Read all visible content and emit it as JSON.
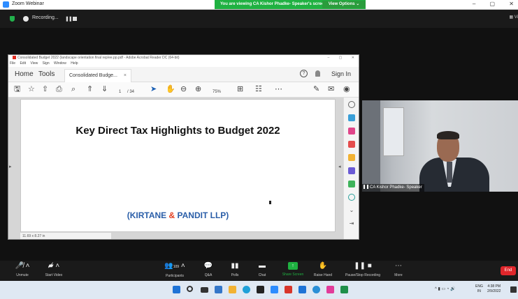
{
  "zoom": {
    "window_title": "Zoom Webinar",
    "viewing_banner": "You are viewing CA Kishor Phadke- Speaker's screen",
    "view_options": "View Options ⌄",
    "win_min": "–",
    "win_max": "▢",
    "win_close": "✕",
    "recording_text": "Recording...",
    "pause_icon": "❚❚",
    "view_btn": "▦ Vi"
  },
  "acrobat": {
    "window_title": "Consolidated Budget 2022 (landscape orientation final rep/ee.pp.pdf - Adobe Acrobat Reader DC (64-bit)",
    "wctrl_min": "–",
    "wctrl_max": "▢",
    "wctrl_close": "✕",
    "menu": [
      "File",
      "Edit",
      "View",
      "Sign",
      "Window",
      "Help"
    ],
    "tab_home": "Home",
    "tab_tools": "Tools",
    "tab_doc": "Consolidated Budge...",
    "tab_close": "×",
    "help_icon": "?",
    "signin": "Sign In",
    "page_field": "1",
    "page_total": "/ 34",
    "zoom_value": "75%",
    "page_size": "11.69 x 8.27 in",
    "slide_title": "Key Direct Tax Highlights to Budget 2022",
    "slide_firm_open": "(",
    "slide_firm_a": "KIRTANE ",
    "slide_firm_amp": "&",
    "slide_firm_b": " PANDIT LLP",
    "slide_firm_close": ")"
  },
  "speaker": {
    "name_label": "CA Kishor Phadke- Speaker"
  },
  "toolbar": {
    "unmute": "Unmute",
    "start_video": "Start Video",
    "participants": "Participants",
    "participants_count": "109",
    "qa": "Q&A",
    "polls": "Polls",
    "chat": "Chat",
    "share_screen": "Share Screen",
    "raise_hand": "Raise Hand",
    "pause_stop_recording": "Pause/Stop Recording",
    "more": "More",
    "end": "End"
  },
  "taskbar": {
    "lang_a": "ENG",
    "lang_b": "IN",
    "time": "4:38 PM",
    "date": "2/9/2022"
  },
  "colors": {
    "zoom_green": "#1fb141",
    "firm_blue": "#2a5ea8",
    "firm_red": "#e23b1c",
    "end_red": "#e0262b"
  }
}
